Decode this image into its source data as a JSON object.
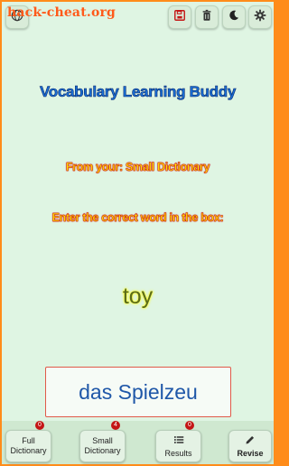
{
  "watermark": "hack-cheat.org",
  "title": "Vocabulary Learning Buddy",
  "subtitle_source": "From your: Small Dictionary",
  "instruction": "Enter the correct word in the box:",
  "prompt_word": "toy",
  "answer_value": "das Spielzeu",
  "top_icons": [
    "globe-icon",
    "save-icon",
    "trash-icon",
    "moon-icon",
    "gear-icon"
  ],
  "nav": {
    "full_dictionary": {
      "line1": "Full",
      "line2": "Dictionary",
      "badge": "0"
    },
    "small_dictionary": {
      "line1": "Small",
      "line2": "Dictionary",
      "badge": "4"
    },
    "results": {
      "label": "Results",
      "badge": "0"
    },
    "revise": {
      "label": "Revise"
    }
  },
  "colors": {
    "frame_border": "#ff8c1a",
    "background": "#dff5e3",
    "title": "#1a6fd6",
    "subtitle_fill": "#ffdd00",
    "subtitle_outline": "#c81414",
    "answer_text": "#1f57a8",
    "answer_border": "#e05a4a",
    "badge": "#c41515"
  }
}
